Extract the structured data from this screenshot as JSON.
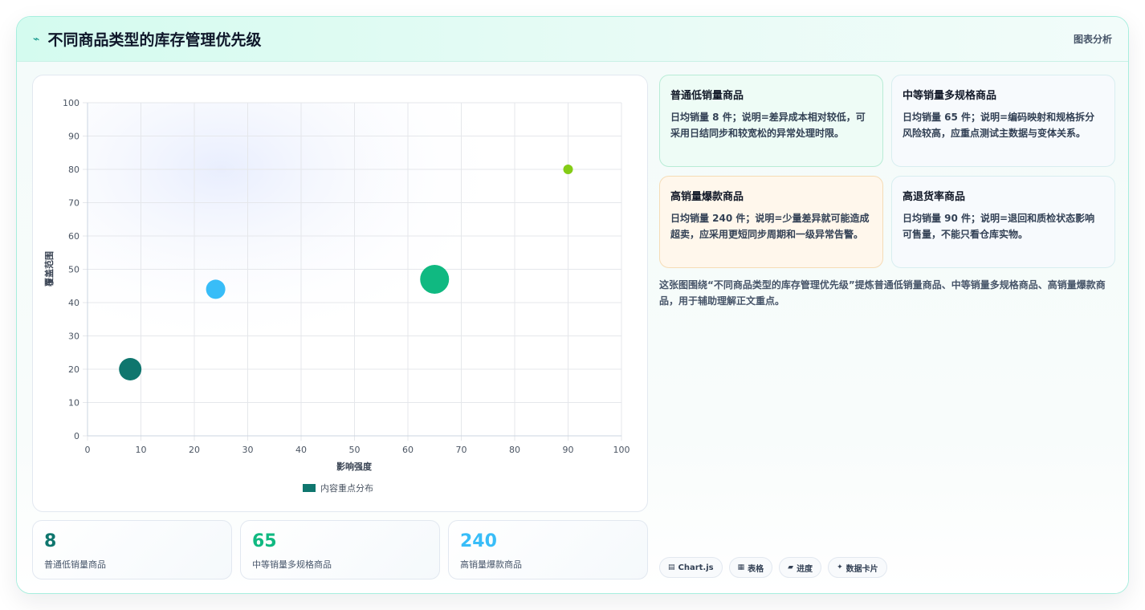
{
  "header": {
    "title": "不同商品类型的库存管理优先级",
    "tag": "图表分析"
  },
  "chart_data": {
    "type": "scatter",
    "xlabel": "影响强度",
    "ylabel": "覆盖范围",
    "xlim": [
      0,
      100
    ],
    "ylim": [
      0,
      100
    ],
    "xticks": [
      "0",
      "10",
      "20",
      "30",
      "40",
      "50",
      "60",
      "70",
      "80",
      "90",
      "100"
    ],
    "yticks": [
      "0",
      "10",
      "20",
      "30",
      "40",
      "50",
      "60",
      "70",
      "80",
      "90",
      "100"
    ],
    "grid": true,
    "legend": {
      "position": "bottom",
      "label": "内容重点分布",
      "color": "#0f766e"
    },
    "points": [
      {
        "x": 8,
        "y": 20,
        "size": 14,
        "color": "#0f766e"
      },
      {
        "x": 24,
        "y": 44,
        "size": 12,
        "color": "#38bdf8"
      },
      {
        "x": 65,
        "y": 47,
        "size": 18,
        "color": "#10b981"
      },
      {
        "x": 90,
        "y": 80,
        "size": 6,
        "color": "#84cc16"
      }
    ]
  },
  "stats": [
    {
      "value": "8",
      "label": "普通低销量商品",
      "color": "#0f766e"
    },
    {
      "value": "65",
      "label": "中等销量多规格商品",
      "color": "#10b981"
    },
    {
      "value": "240",
      "label": "高销量爆款商品",
      "color": "#38bdf8"
    }
  ],
  "cards": [
    {
      "title": "普通低销量商品",
      "body": "日均销量 8 件；说明=差异成本相对较低，可采用日结同步和较宽松的异常处理时限。"
    },
    {
      "title": "中等销量多规格商品",
      "body": "日均销量 65 件；说明=编码映射和规格拆分风险较高，应重点测试主数据与变体关系。"
    },
    {
      "title": "高销量爆款商品",
      "body": "日均销量 240 件；说明=少量差异就可能造成超卖，应采用更短同步周期和一级异常告警。"
    },
    {
      "title": "高退货率商品",
      "body": "日均销量 90 件；说明=退回和质检状态影响可售量，不能只看仓库实物。"
    }
  ],
  "summary": "这张图围绕“不同商品类型的库存管理优先级”提炼普通低销量商品、中等销量多规格商品、高销量爆款商品，用于辅助理解正文重点。",
  "chips": [
    {
      "icon": "▤",
      "label": "Chart.js"
    },
    {
      "icon": "▦",
      "label": "表格"
    },
    {
      "icon": "▰",
      "label": "进度"
    },
    {
      "icon": "✦",
      "label": "数据卡片"
    }
  ]
}
